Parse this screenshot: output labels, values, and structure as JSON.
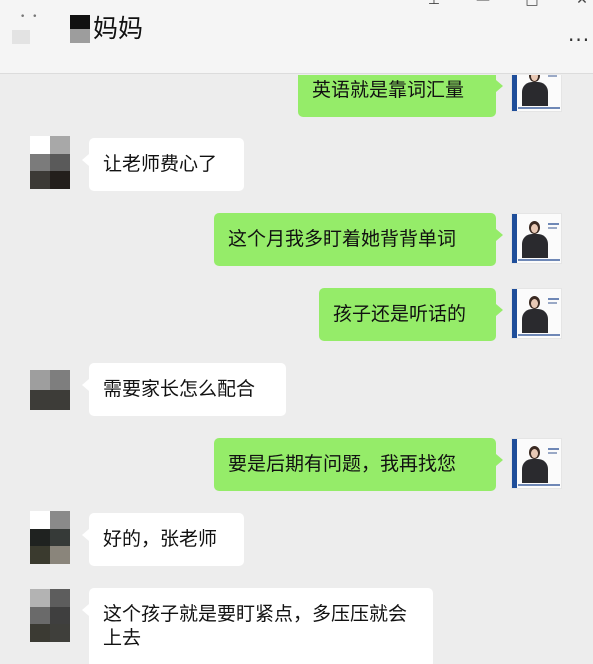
{
  "header": {
    "title": "妈妈",
    "window_controls": [
      "pin-icon",
      "minimize-icon",
      "maximize-icon",
      "close-icon"
    ],
    "more_icon": "ellipsis-icon"
  },
  "messages": [
    {
      "side": "right",
      "text": "英语就是靠词汇量"
    },
    {
      "side": "left",
      "text": "让老师费心了"
    },
    {
      "side": "right",
      "text": "这个月我多盯着她背背单词"
    },
    {
      "side": "right",
      "text": "孩子还是听话的"
    },
    {
      "side": "left",
      "text": "需要家长怎么配合"
    },
    {
      "side": "right",
      "text": "要是后期有问题，我再找您"
    },
    {
      "side": "left",
      "text": "好的，张老师"
    },
    {
      "side": "left",
      "text": "这个孩子就是要盯紧点，多压压就会上去"
    }
  ],
  "colors": {
    "self_bubble": "#95ec69",
    "other_bubble": "#ffffff",
    "background": "#ededed"
  }
}
